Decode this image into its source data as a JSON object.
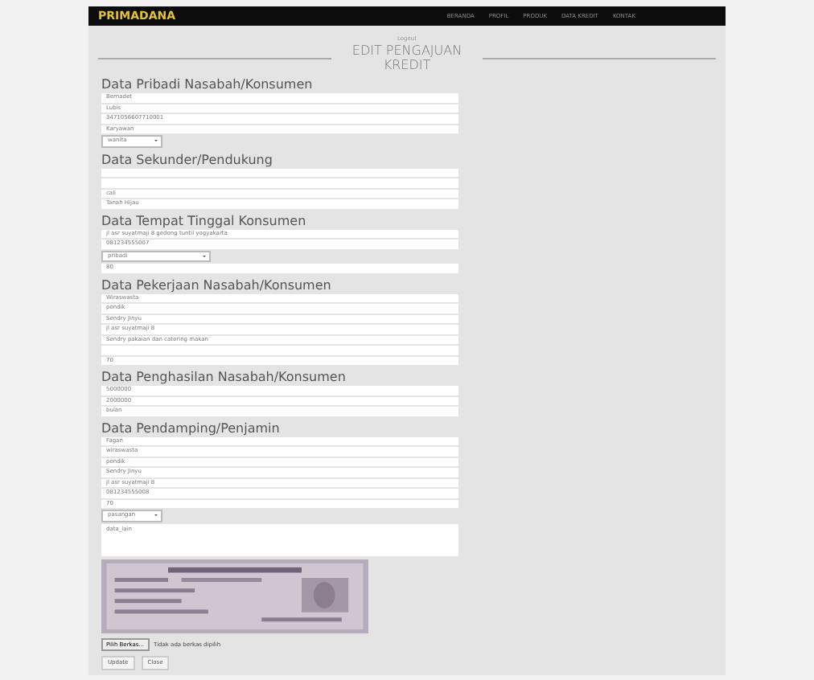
{
  "navbar": {
    "brand": "PRIMADANA",
    "items": [
      {
        "label": "BERANDA",
        "selected": false
      },
      {
        "label": "PROFIL",
        "selected": false
      },
      {
        "label": "PRODUK",
        "selected": false
      },
      {
        "label": "DATA KREDIT",
        "selected": false
      },
      {
        "label": "KONTAK",
        "selected": false
      }
    ]
  },
  "logout": "Logout",
  "title": "EDIT PENGAJUAN KREDIT",
  "sections": [
    {
      "heading": "Data Pribadi Nasabah/Konsumen",
      "fields": [
        {
          "kind": "text",
          "value": "Bernadet"
        },
        {
          "kind": "text",
          "value": "Lubis"
        },
        {
          "kind": "text",
          "value": "3471056607710001"
        },
        {
          "kind": "text",
          "value": "Karyawan"
        },
        {
          "kind": "select",
          "value": "wanita"
        }
      ]
    },
    {
      "heading": "Data Sekunder/Pendukung",
      "fields": [
        {
          "kind": "text"
        },
        {
          "kind": "text"
        },
        {
          "kind": "text",
          "value": "cali"
        },
        {
          "kind": "text",
          "value": "Tanah Hijau"
        }
      ]
    },
    {
      "heading": "Data Tempat Tinggal Konsumen",
      "fields": [
        {
          "kind": "text",
          "value": "jl asr suyatmaji 8 gedong tuntil yogyakarta"
        },
        {
          "kind": "text",
          "value": "081234555007"
        },
        {
          "kind": "wideselect",
          "value": "pribadi"
        },
        {
          "kind": "text",
          "value": "80"
        }
      ]
    },
    {
      "heading": "Data Pekerjaan Nasabah/Konsumen",
      "fields": [
        {
          "kind": "text",
          "value": "Wiraswasta"
        },
        {
          "kind": "text",
          "value": "pondik"
        },
        {
          "kind": "text",
          "value": "Sendry Jinyu"
        },
        {
          "kind": "text",
          "value": "jl asr suyatmaji 8"
        },
        {
          "kind": "text",
          "value": "Sendry pakaian dan catering makan"
        },
        {
          "kind": "text"
        },
        {
          "kind": "text",
          "value": "70"
        }
      ]
    },
    {
      "heading": "Data Penghasilan Nasabah/Konsumen",
      "fields": [
        {
          "kind": "text",
          "value": "5000000"
        },
        {
          "kind": "text",
          "value": "2000000"
        },
        {
          "kind": "text",
          "value": "bulan"
        }
      ]
    },
    {
      "heading": "Data Pendamping/Penjamin",
      "fields": [
        {
          "kind": "text",
          "value": "Fagan"
        },
        {
          "kind": "text",
          "value": "wiraswasta"
        },
        {
          "kind": "text",
          "value": "pondik"
        },
        {
          "kind": "text",
          "value": "Sendry Jinyu"
        },
        {
          "kind": "text",
          "value": "jl asr suyatmaji 8"
        },
        {
          "kind": "text",
          "value": "081234555008"
        },
        {
          "kind": "text",
          "value": "70"
        },
        {
          "kind": "select",
          "value": "pasangan"
        },
        {
          "kind": "textarea",
          "value": "data_lain"
        }
      ]
    }
  ],
  "attachment": {
    "kind": "picture"
  },
  "file_input": {
    "button": "Pilih Berkas...",
    "status": "Tidak ada berkas dipilih"
  },
  "buttons": [
    "Update",
    "Close"
  ]
}
